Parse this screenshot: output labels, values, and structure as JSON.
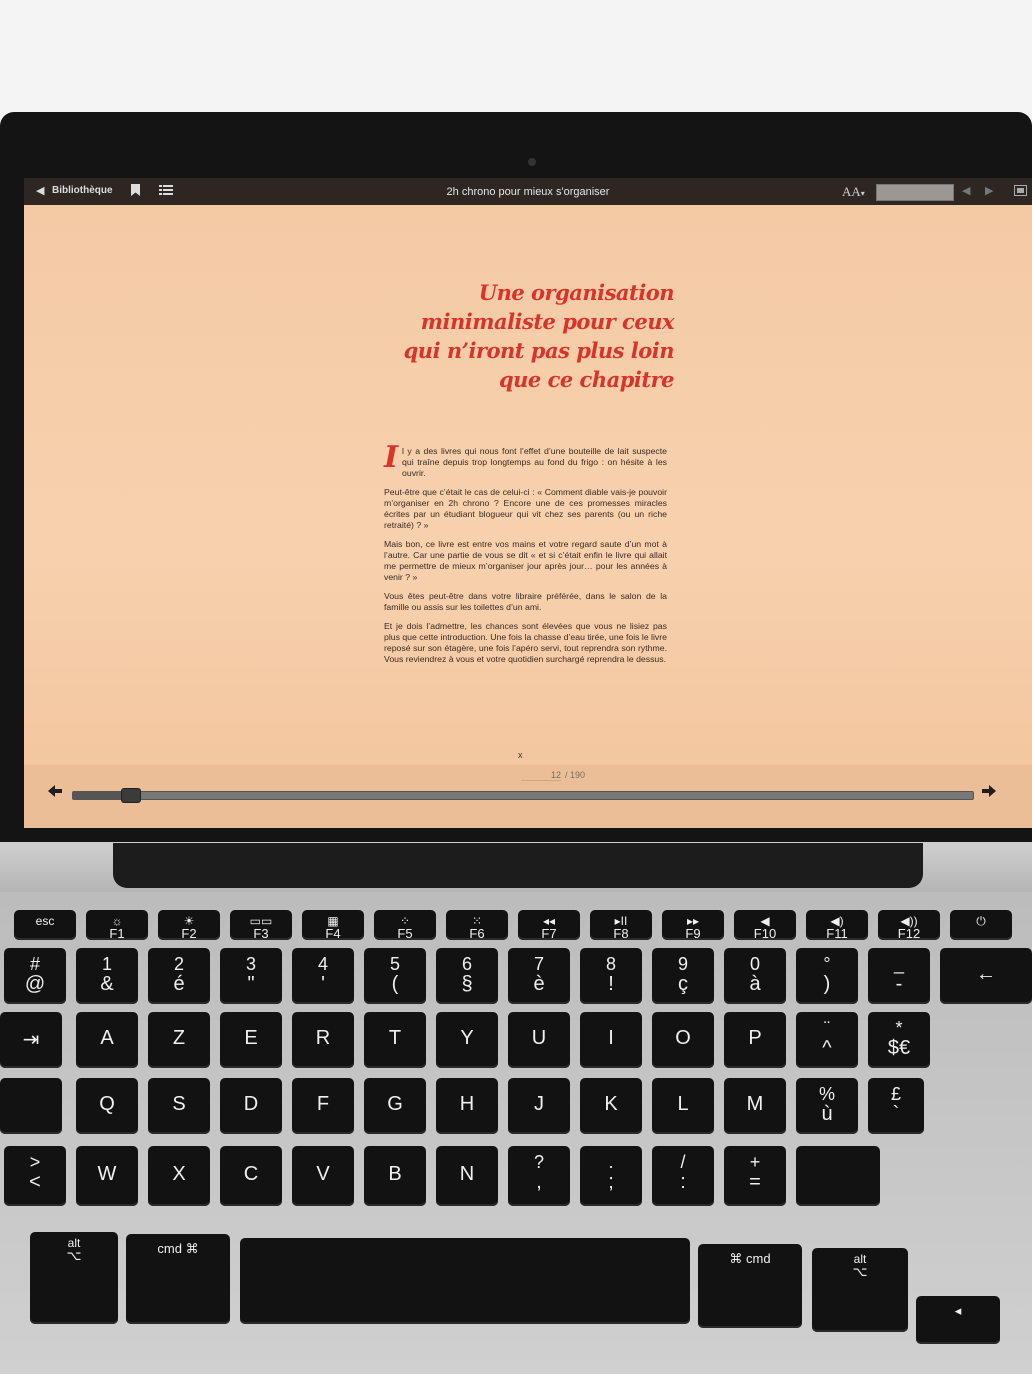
{
  "reader": {
    "library_label": "Bibliothèque",
    "book_title": "2h chrono pour mieux s'organiser",
    "font_button": "AA",
    "icons": {
      "back": "triangle-left-icon",
      "bookmark": "bookmark-icon",
      "toc": "list-icon",
      "prev": "triangle-left-icon",
      "next": "triangle-right-icon",
      "fullscreen": "fullscreen-icon"
    }
  },
  "page": {
    "chapter_title": [
      "Une organisation",
      "minimaliste pour ceux",
      "qui n’iront pas plus loin",
      "que ce chapitre"
    ],
    "dropcap": "I",
    "first_paragraph": "l y a des livres qui nous font l’effet d’une bouteille de lait suspecte qui traîne depuis trop longtemps au fond du frigo : on hésite à les ouvrir.",
    "paragraphs": [
      "Peut-être que c’était le cas de celui-ci : « Comment diable vais-je pouvoir m’organiser en 2h chrono ? Encore une de ces promesses miracles écrites par un étudiant blogueur qui vit chez ses parents (ou un riche retraité) ? »",
      "Mais bon, ce livre est entre vos mains et votre regard saute d’un mot à l’autre. Car une partie de vous se dit « et si c’était enfin le livre qui allait me permettre de mieux m’organiser jour après jour… pour les années à venir ? »",
      "Vous êtes peut-être dans votre libraire préférée, dans le salon de la famille ou assis sur les toilettes d’un ami.",
      "Et je dois l’admettre, les chances sont élevées que vous ne lisiez pas plus que cette introduction. Une fois la chasse d’eau tirée, une fois le livre reposé sur son étagère, une fois l’apéro servi, tout reprendra son rythme. Vous reviendrez à vous et votre quotidien surchargé reprendra le dessus."
    ],
    "page_marker": "x"
  },
  "navigation": {
    "current_page": "12",
    "total_pages": "/ 190",
    "progress_fraction": 0.063
  },
  "keyboard": {
    "fn_row": [
      {
        "main": "esc",
        "sub": ""
      },
      {
        "main": "☼",
        "sub": "F1"
      },
      {
        "main": "☀",
        "sub": "F2"
      },
      {
        "main": "▭▭",
        "sub": "F3"
      },
      {
        "main": "▦",
        "sub": "F4"
      },
      {
        "main": "⁘",
        "sub": "F5"
      },
      {
        "main": "⁙",
        "sub": "F6"
      },
      {
        "main": "◂◂",
        "sub": "F7"
      },
      {
        "main": "▸II",
        "sub": "F8"
      },
      {
        "main": "▸▸",
        "sub": "F9"
      },
      {
        "main": "◀",
        "sub": "F10"
      },
      {
        "main": "◀)",
        "sub": "F11"
      },
      {
        "main": "◀))",
        "sub": "F12"
      },
      {
        "main": "⏻",
        "sub": ""
      }
    ],
    "number_row": [
      {
        "top": "#",
        "bottom": "@"
      },
      {
        "top": "1",
        "bottom": "&"
      },
      {
        "top": "2",
        "bottom": "é"
      },
      {
        "top": "3",
        "bottom": "\""
      },
      {
        "top": "4",
        "bottom": "'"
      },
      {
        "top": "5",
        "bottom": "("
      },
      {
        "top": "6",
        "bottom": "§"
      },
      {
        "top": "7",
        "bottom": "è"
      },
      {
        "top": "8",
        "bottom": "!"
      },
      {
        "top": "9",
        "bottom": "ç"
      },
      {
        "top": "0",
        "bottom": "à"
      },
      {
        "top": "°",
        "bottom": ")"
      },
      {
        "top": "_",
        "bottom": "-"
      },
      {
        "top": "",
        "bottom": "←"
      }
    ],
    "row_azerty": [
      {
        "top": "",
        "bottom": "A"
      },
      {
        "top": "",
        "bottom": "Z"
      },
      {
        "top": "",
        "bottom": "E"
      },
      {
        "top": "",
        "bottom": "R"
      },
      {
        "top": "",
        "bottom": "T"
      },
      {
        "top": "",
        "bottom": "Y"
      },
      {
        "top": "",
        "bottom": "U"
      },
      {
        "top": "",
        "bottom": "I"
      },
      {
        "top": "",
        "bottom": "O"
      },
      {
        "top": "",
        "bottom": "P"
      },
      {
        "top": "¨",
        "bottom": "^"
      },
      {
        "top": "*",
        "bottom": "$€"
      }
    ],
    "row_qsdf": [
      {
        "top": "",
        "bottom": "Q"
      },
      {
        "top": "",
        "bottom": "S"
      },
      {
        "top": "",
        "bottom": "D"
      },
      {
        "top": "",
        "bottom": "F"
      },
      {
        "top": "",
        "bottom": "G"
      },
      {
        "top": "",
        "bottom": "H"
      },
      {
        "top": "",
        "bottom": "J"
      },
      {
        "top": "",
        "bottom": "K"
      },
      {
        "top": "",
        "bottom": "L"
      },
      {
        "top": "",
        "bottom": "M"
      },
      {
        "top": "%",
        "bottom": "ù"
      },
      {
        "top": "£",
        "bottom": "`"
      }
    ],
    "row_wxcv": [
      {
        "top": ">",
        "bottom": "<"
      },
      {
        "top": "",
        "bottom": "W"
      },
      {
        "top": "",
        "bottom": "X"
      },
      {
        "top": "",
        "bottom": "C"
      },
      {
        "top": "",
        "bottom": "V"
      },
      {
        "top": "",
        "bottom": "B"
      },
      {
        "top": "",
        "bottom": "N"
      },
      {
        "top": "?",
        "bottom": ","
      },
      {
        "top": ".",
        "bottom": ";"
      },
      {
        "top": "/",
        "bottom": ":"
      },
      {
        "top": "+",
        "bottom": "="
      },
      {
        "top": "",
        "bottom": ""
      }
    ],
    "row_bottom": {
      "alt_left": {
        "top": "alt",
        "bottom": "⌥"
      },
      "cmd_left": {
        "top": "",
        "bottom": "cmd  ⌘"
      },
      "cmd_right": {
        "top": "",
        "bottom": "⌘  cmd"
      },
      "alt_right": {
        "top": "alt",
        "bottom": "⌥"
      },
      "arrow_left": {
        "top": "",
        "bottom": "◂"
      }
    }
  }
}
